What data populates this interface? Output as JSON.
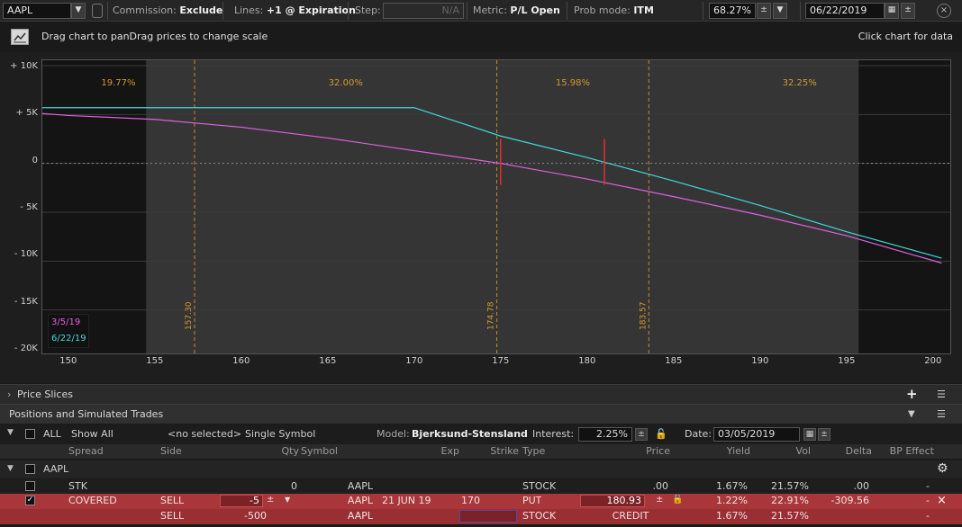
{
  "toolbar": {
    "symbol": "AAPL",
    "commission_label": "Commission:",
    "commission_value": "Exclude",
    "lines_label": "Lines:",
    "lines_value": "+1 @ Expiration",
    "step_label": "Step:",
    "step_value": "N/A",
    "metric_label": "Metric:",
    "metric_value": "P/L Open",
    "prob_mode_label": "Prob mode:",
    "prob_mode_value": "ITM",
    "prob_percent": "68.27%",
    "date": "06/22/2019"
  },
  "hints": {
    "drag": "Drag chart to panDrag prices to change scale",
    "click": "Click chart for data"
  },
  "chart_data": {
    "type": "line",
    "x": [
      148.5,
      150,
      155,
      160,
      165,
      170,
      175,
      180,
      185,
      190,
      195,
      200.5
    ],
    "series": [
      {
        "name": "3/5/19",
        "color": "#e060e0",
        "values": [
          5100,
          4900,
          4500,
          3700,
          2600,
          1300,
          0,
          -1600,
          -3400,
          -5300,
          -7400,
          -10200
        ]
      },
      {
        "name": "6/22/19",
        "color": "#40d8d8",
        "values": [
          5700,
          5700,
          5700,
          5700,
          5700,
          5700,
          2800,
          600,
          -1800,
          -4300,
          -7000,
          -9700
        ]
      }
    ],
    "y_ticks": [
      "+ 10K",
      "+ 5K",
      "0",
      "- 5K",
      "- 10K",
      "- 15K",
      "- 20K"
    ],
    "x_ticks": [
      "150",
      "155",
      "160",
      "165",
      "170",
      "175",
      "180",
      "185",
      "190",
      "195",
      "200"
    ],
    "ylim": [
      -20000,
      10000
    ],
    "xlim": [
      148.5,
      201
    ],
    "probability_zones": [
      {
        "from": 148.5,
        "to": 157.3,
        "label": "19.77%"
      },
      {
        "from": 157.3,
        "to": 174.78,
        "label": "32.00%"
      },
      {
        "from": 174.78,
        "to": 183.57,
        "label": "15.98%"
      },
      {
        "from": 183.57,
        "to": 201,
        "label": "32.25%"
      }
    ],
    "vertical_lines": [
      "157.30",
      "174.78",
      "183.57"
    ],
    "vertical_line_values": [
      157.3,
      174.78,
      183.57
    ],
    "marker_prices": [
      175,
      181
    ],
    "shaded_band": [
      154.5,
      195.7
    ]
  },
  "price_slices": {
    "label": "Price Slices"
  },
  "positions": {
    "title": "Positions and Simulated Trades",
    "filter": {
      "all_label": "ALL",
      "show_all": "Show All",
      "selected": "<no selected>",
      "single_symbol": "Single Symbol",
      "model_label": "Model:",
      "model_value": "Bjerksund-Stensland",
      "interest_label": "Interest:",
      "interest_value": "2.25%",
      "date_label": "Date:",
      "date_value": "03/05/2019"
    },
    "columns": [
      "Spread",
      "Side",
      "Qty",
      "Symbol",
      "Exp",
      "Strike",
      "Type",
      "Price",
      "Yield",
      "Vol",
      "Delta",
      "BP Effect"
    ],
    "group": "AAPL",
    "rows": [
      {
        "spread": "STK",
        "side": "",
        "qty": "0",
        "symbol": "AAPL",
        "exp": "",
        "strike": "",
        "type": "STOCK",
        "price": ".00",
        "yield": "1.67%",
        "vol": "21.57%",
        "delta": ".00",
        "bp": "-"
      },
      {
        "spread": "COVERED",
        "side": "SELL",
        "qty": "-5",
        "symbol": "AAPL",
        "exp": "21 JUN 19",
        "strike": "170",
        "type": "PUT",
        "price": "180.93",
        "yield": "1.22%",
        "vol": "22.91%",
        "delta": "-309.56",
        "bp": "-"
      },
      {
        "spread": "",
        "side": "SELL",
        "qty": "-500",
        "symbol": "AAPL",
        "exp": "",
        "strike": "",
        "type": "STOCK",
        "price": "CREDIT",
        "yield": "1.67%",
        "vol": "21.57%",
        "delta": "",
        "bp": "-"
      }
    ]
  }
}
